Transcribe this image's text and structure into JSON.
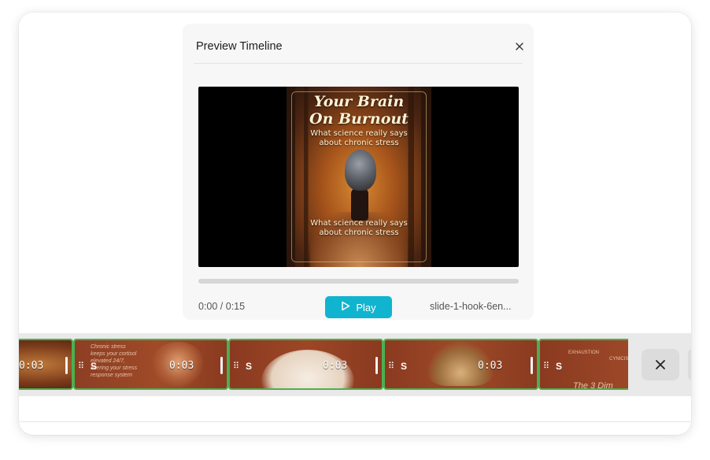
{
  "dialog": {
    "title": "Preview Timeline",
    "close_icon": "close-icon"
  },
  "preview": {
    "poster": {
      "title_line1": "Your Brain",
      "title_line2": "On Burnout",
      "subtitle_top_line1": "What science really says",
      "subtitle_top_line2": "about chronic stress",
      "subtitle_bottom_line1": "What science really says",
      "subtitle_bottom_line2": "about chronic stress"
    },
    "progress": 0,
    "time": "0:00 / 0:15",
    "play_label": "Play",
    "play_icon": "play-icon",
    "filename": "slide-1-hook-6en..."
  },
  "timeline": {
    "clips": [
      {
        "label": "",
        "duration": "0:03",
        "handle_icon": "drag-handle-icon"
      },
      {
        "label": "S",
        "duration": "0:03",
        "handle_icon": "drag-handle-icon",
        "note_lines": [
          "Chronic stress",
          "keeps your cortisol",
          "elevated 24/7,",
          "altering your stress",
          "response system"
        ]
      },
      {
        "label": "S",
        "duration": "0:03",
        "handle_icon": "drag-handle-icon"
      },
      {
        "label": "S",
        "duration": "0:03",
        "handle_icon": "drag-handle-icon"
      },
      {
        "label": "S",
        "duration": "",
        "handle_icon": "drag-handle-icon",
        "notes": [
          "EXHAUSTION",
          "CYNICISM",
          "The 3 Dim"
        ]
      }
    ],
    "close_icon": "close-icon"
  },
  "colors": {
    "accent": "#10b4cf",
    "clip_border": "#4caf50",
    "clip_bg": "#8a3e22"
  }
}
